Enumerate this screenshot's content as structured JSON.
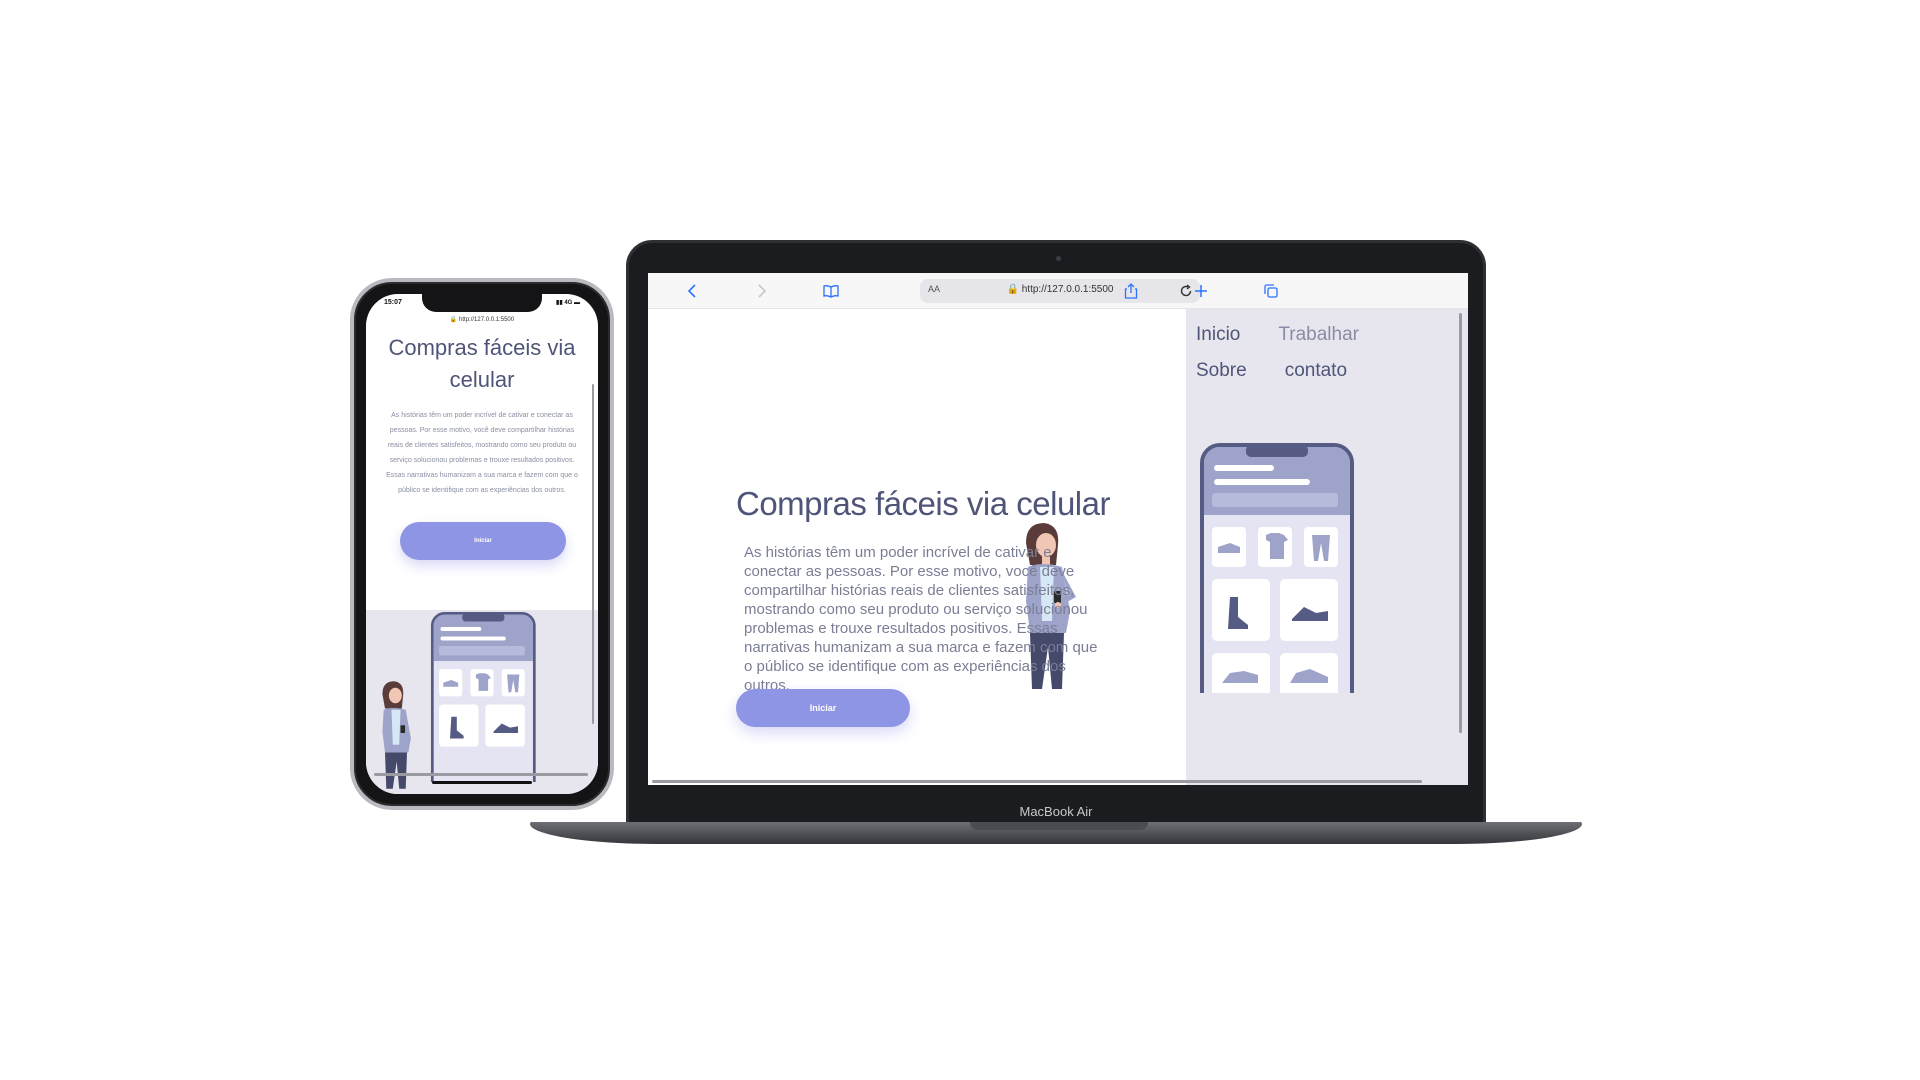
{
  "laptop": {
    "brand": "MacBook Air",
    "browser": {
      "aa_label": "AA",
      "url": "http://127.0.0.1:5500"
    },
    "nav": {
      "items": [
        "Inicio",
        "Trabalhar",
        "Sobre",
        "contato"
      ]
    },
    "hero": {
      "title": "Compras fáceis via celular",
      "text": "As histórias têm um poder incrível de cativar e conectar as pessoas. Por esse motivo, você deve compartilhar histórias reais de clientes satisfeitos, mostrando como seu produto ou serviço solucionou problemas e trouxe resultados positivos. Essas narrativas humanizam a sua marca e fazem com que o público se identifique com as experiências dos outros.",
      "button": "Iniciar"
    }
  },
  "phone": {
    "time": "15:07",
    "signal": "4G",
    "url": "http://127.0.0.1:5500",
    "title": "Compras fáceis via celular",
    "text": "As histórias têm um poder incrível de cativar e conectar as pessoas. Por esse motivo, você deve compartilhar histórias reais de clientes satisfeitos, mostrando como seu produto ou serviço solucionou problemas e trouxe resultados positivos. Essas narrativas humanizam a sua marca e fazem com que o público se identifique com as experiências dos outros.",
    "button": "Iniciar"
  },
  "colors": {
    "accent": "#8f95e5",
    "text_dark": "#4f5578",
    "panel": "#e7e6ee",
    "illus_phone": "#555b82",
    "illus_light": "#9ea3c9"
  }
}
